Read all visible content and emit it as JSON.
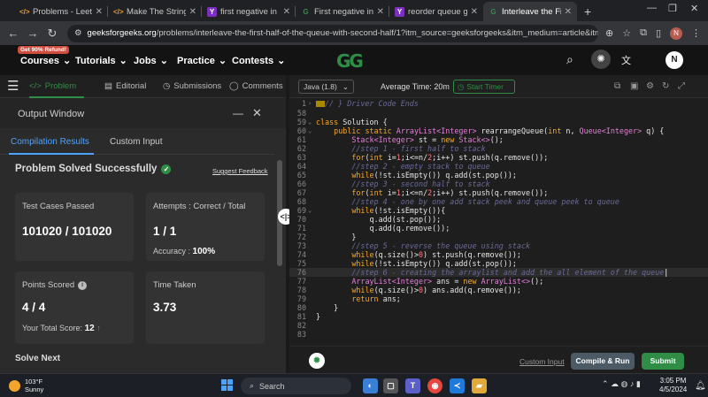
{
  "browser": {
    "tabs": [
      {
        "title": "Problems - LeetCode",
        "fav": "</>",
        "favcolor": "#f0a030"
      },
      {
        "title": "Make The String Great",
        "fav": "</>",
        "favcolor": "#f0a030"
      },
      {
        "title": "first negative in every",
        "fav": "Y",
        "favcolor": "#7b2fbe"
      },
      {
        "title": "First negative integer",
        "fav": "G",
        "favcolor": "#2f8d46"
      },
      {
        "title": "reorder queue gfg pr",
        "fav": "Y",
        "favcolor": "#7b2fbe"
      },
      {
        "title": "Interleave the First H",
        "fav": "G",
        "favcolor": "#2f8d46"
      }
    ],
    "url_host": "geeksforgeeks.org",
    "url_path": "/problems/interleave-the-first-half-of-the-queue-with-second-half/1?itm_source=geeksforgeeks&itm_medium=article&itm_camp...",
    "profile_initial": "N"
  },
  "site": {
    "promo": "Get 90% Refund!",
    "nav": [
      "Courses",
      "Tutorials",
      "Jobs",
      "Practice",
      "Contests"
    ],
    "logo": "GG",
    "avatar": "N"
  },
  "problem_tabs": [
    "Problem",
    "Editorial",
    "Submissions",
    "Comments"
  ],
  "output": {
    "title": "Output Window",
    "tabs": [
      "Compilation Results",
      "Custom Input"
    ],
    "status": "Problem Solved Successfully",
    "suggest": "Suggest Feedback",
    "test_cases_label": "Test Cases Passed",
    "test_cases_value": "101020 / 101020",
    "attempts_label": "Attempts : Correct / Total",
    "attempts_value": "1 / 1",
    "accuracy_label": "Accuracy :",
    "accuracy_value": "100%",
    "points_label": "Points Scored",
    "points_value": "4 / 4",
    "total_score_label": "Your Total Score:",
    "total_score_value": "12",
    "time_label": "Time Taken",
    "time_value": "3.73",
    "solve_next": "Solve Next"
  },
  "editor": {
    "language": "Java (1.8)",
    "avg_time": "Average Time: 20m",
    "timer": "Start Timer",
    "custom_input": "Custom Input",
    "compile": "Compile & Run",
    "submit": "Submit",
    "folded_comment": "// } Driver Code Ends"
  },
  "taskbar": {
    "temp": "103°F",
    "weather": "Sunny",
    "search": "Search",
    "time": "3:05 PM",
    "date": "4/5/2024"
  }
}
